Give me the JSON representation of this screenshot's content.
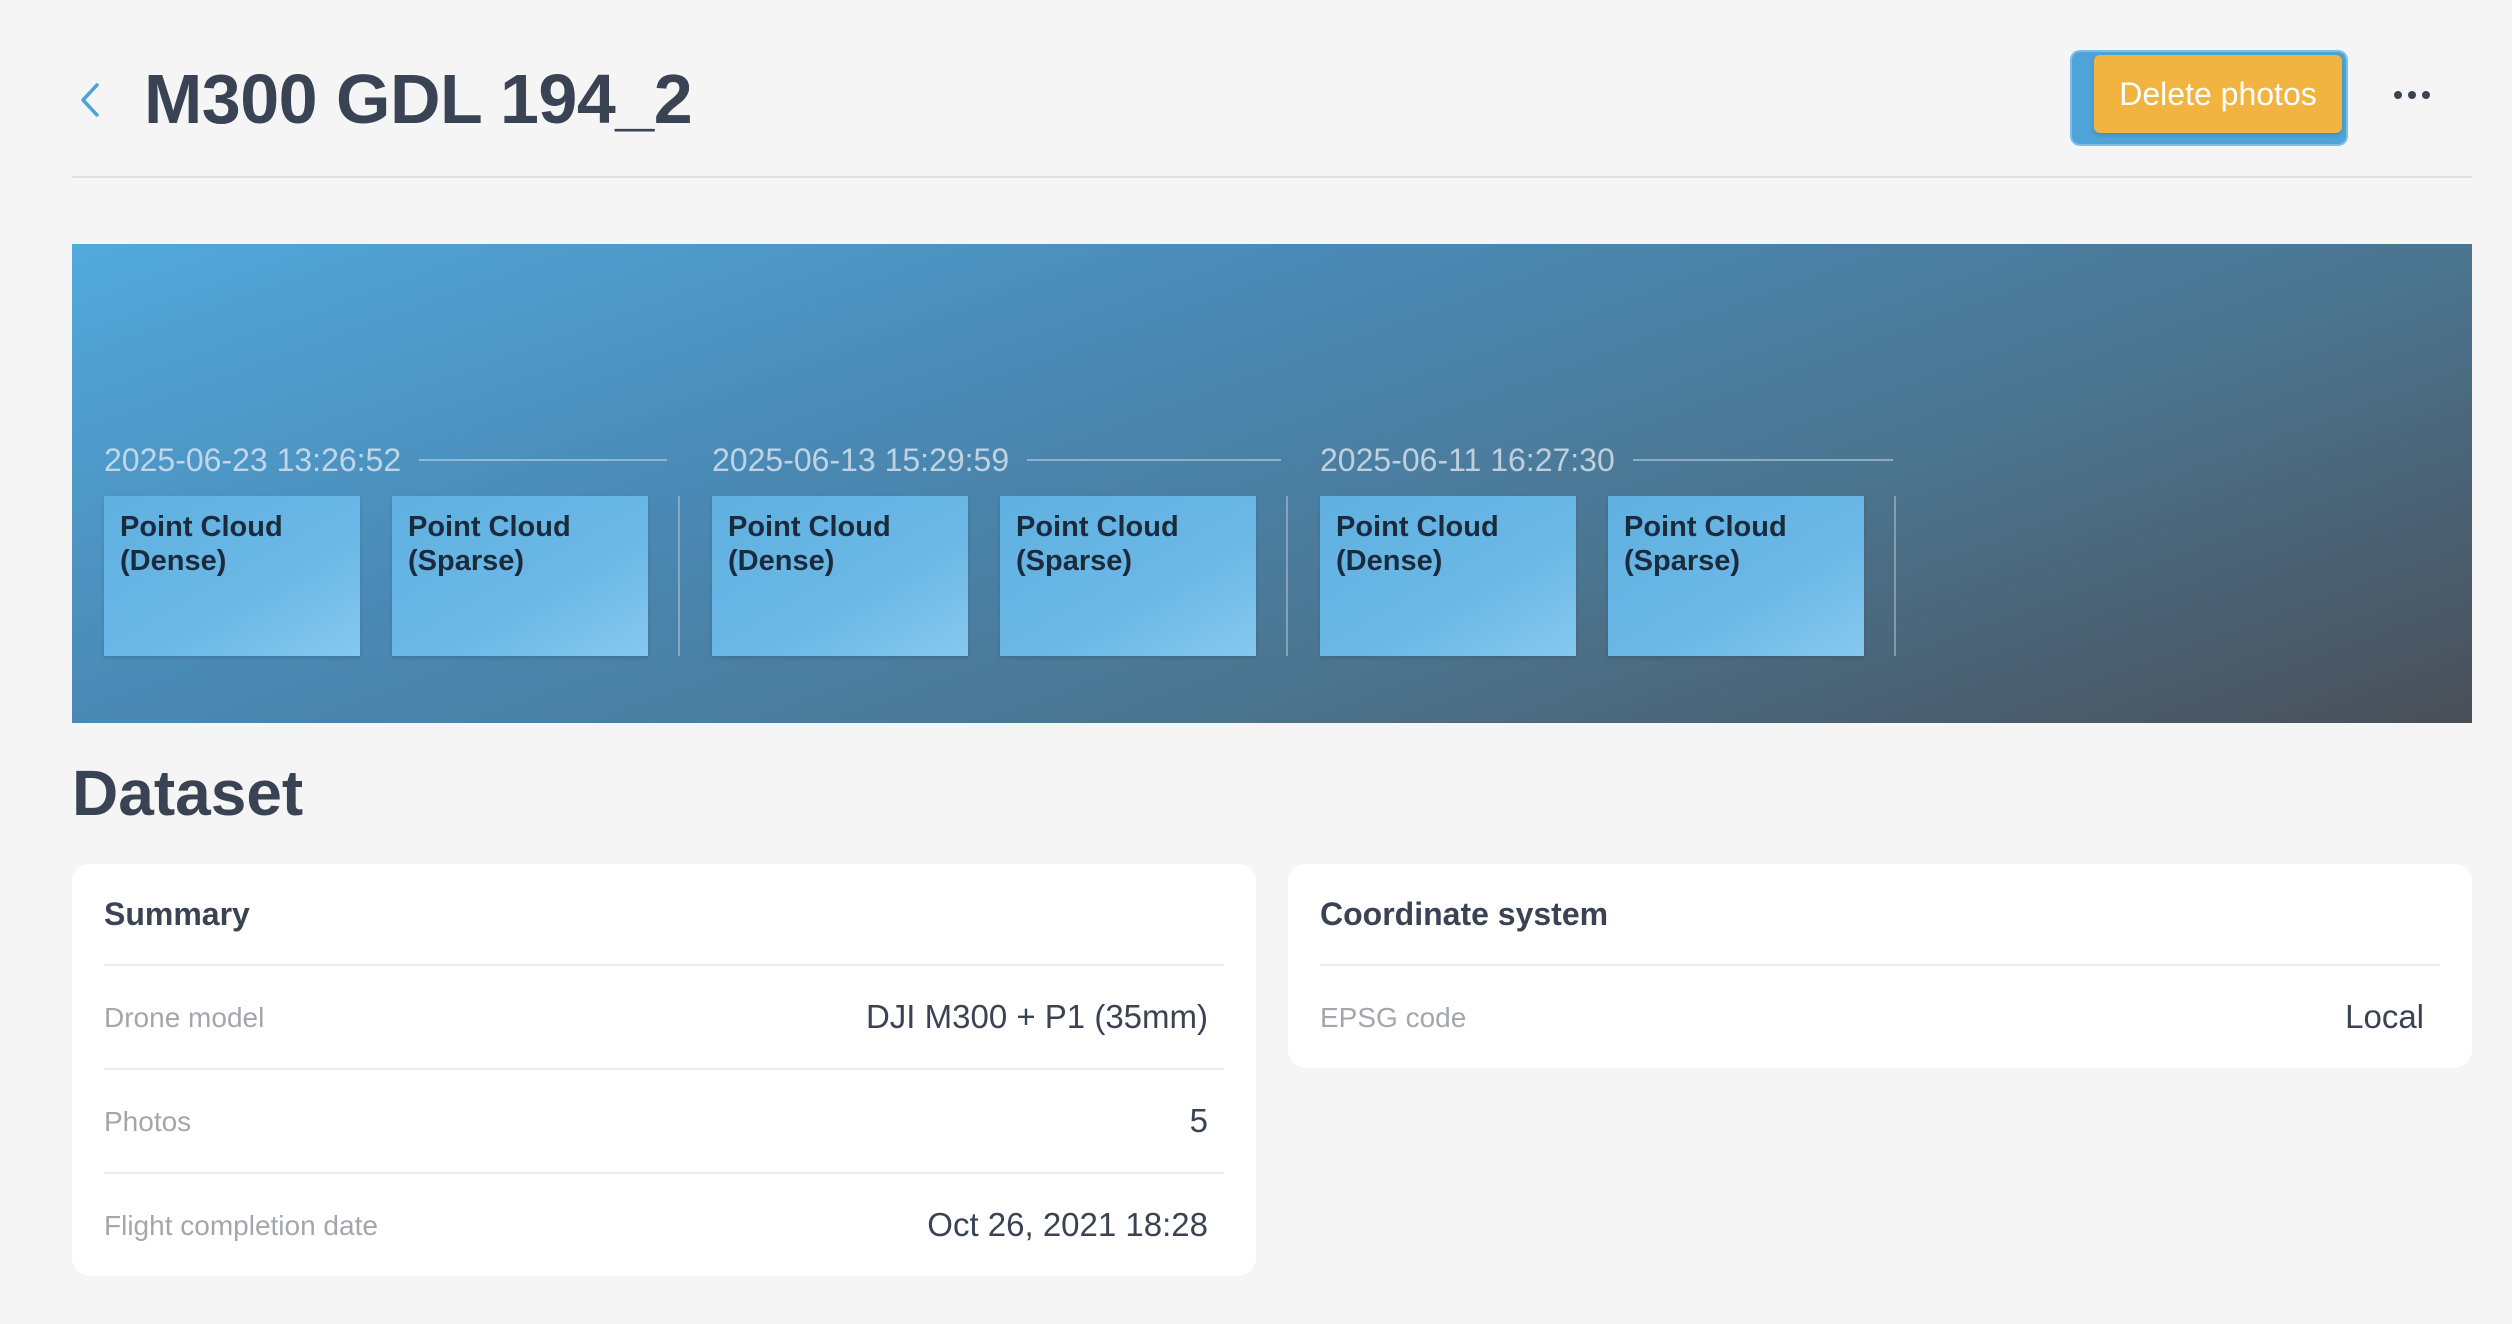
{
  "header": {
    "title": "M300 GDL 194_2",
    "delete_label": "Delete photos"
  },
  "timeline": [
    {
      "date": "2025-06-23 13:26:52",
      "tiles": [
        {
          "line1": "Point Cloud",
          "line2": "(Dense)"
        },
        {
          "line1": "Point Cloud",
          "line2": "(Sparse)"
        }
      ]
    },
    {
      "date": "2025-06-13 15:29:59",
      "tiles": [
        {
          "line1": "Point Cloud",
          "line2": "(Dense)"
        },
        {
          "line1": "Point Cloud",
          "line2": "(Sparse)"
        }
      ]
    },
    {
      "date": "2025-06-11 16:27:30",
      "tiles": [
        {
          "line1": "Point Cloud",
          "line2": "(Dense)"
        },
        {
          "line1": "Point Cloud",
          "line2": "(Sparse)"
        }
      ]
    }
  ],
  "dataset": {
    "title": "Dataset",
    "summary": {
      "title": "Summary",
      "rows": [
        {
          "label": "Drone model",
          "value": "DJI M300 + P1 (35mm)"
        },
        {
          "label": "Photos",
          "value": "5"
        },
        {
          "label": "Flight completion date",
          "value": "Oct 26, 2021 18:28"
        }
      ]
    },
    "coordinate_system": {
      "title": "Coordinate system",
      "rows": [
        {
          "label": "EPSG code",
          "value": "Local"
        }
      ]
    }
  },
  "colors": {
    "accent_blue": "#4ea3d8",
    "button_orange": "#f1b440",
    "text_dark": "#3a4354",
    "text_muted": "#a3a7ad",
    "background": "#f5f5f5"
  },
  "icons": {
    "back": "chevron-left-icon",
    "more": "more-horizontal-icon"
  }
}
